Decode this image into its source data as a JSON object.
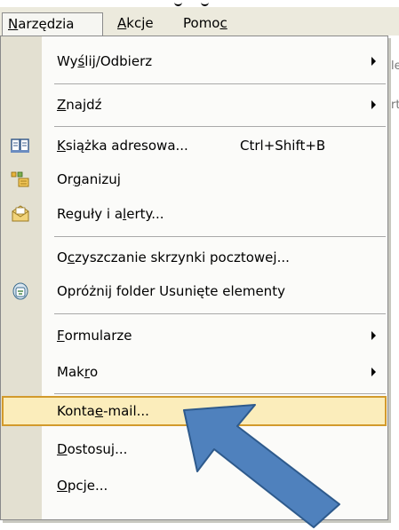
{
  "menubar": {
    "items": [
      {
        "pre": "",
        "key": "N",
        "post": "arzędzia"
      },
      {
        "pre": "",
        "key": "A",
        "post": "kcje"
      },
      {
        "pre": "Pomo",
        "key": "c",
        "post": ""
      }
    ]
  },
  "menu": {
    "send_receive": {
      "pre": "Wy",
      "key": "ś",
      "post": "lij/Odbierz"
    },
    "find": {
      "pre": "",
      "key": "Z",
      "post": "najdź"
    },
    "address_book": {
      "pre": "",
      "key": "K",
      "post": "siążka adresowa...",
      "shortcut": "Ctrl+Shift+B"
    },
    "organize": {
      "pre": "Or",
      "key": "g",
      "post": "anizuj"
    },
    "rules": {
      "pre": "Reguły i a",
      "key": "l",
      "post": "erty..."
    },
    "mailbox_cleanup": {
      "pre": "O",
      "key": "c",
      "post": "zyszczanie skrzynki pocztowej..."
    },
    "empty_deleted": {
      "label": "Opróżnij folder Usunięte elementy"
    },
    "forms": {
      "pre": "",
      "key": "F",
      "post": "ormularze"
    },
    "macro": {
      "pre": "Mak",
      "key": "r",
      "post": "o"
    },
    "email_accounts": {
      "pre": "Konta ",
      "key": "e",
      "post": "-mail..."
    },
    "customize": {
      "pre": "",
      "key": "D",
      "post": "ostosuj..."
    },
    "options": {
      "pre": "",
      "key": "O",
      "post": "pcje..."
    }
  },
  "background": {
    "frag1": "le",
    "frag2": "rt"
  },
  "colors": {
    "highlight": "#fbedbb",
    "highlight_border": "#d29a2c",
    "arrow": "#4f81bd",
    "arrow_outline": "#2e5a8c"
  }
}
